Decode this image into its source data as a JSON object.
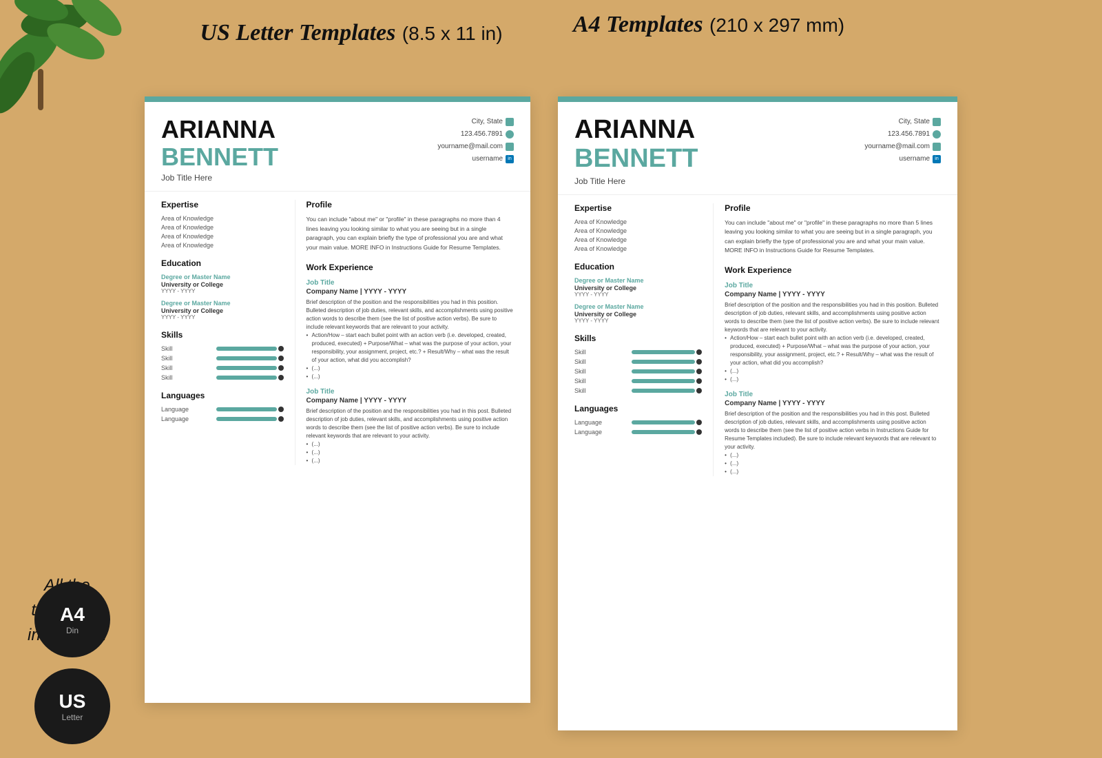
{
  "page": {
    "background_color": "#d4a96a"
  },
  "labels": {
    "us_template_title": "US Letter Templates",
    "us_template_size": "(8.5 x 11 in)",
    "a4_template_title": "A4 Templates",
    "a4_template_size": "(210 x 297 mm)",
    "side_text_line1": "All the",
    "side_text_line2": "templates",
    "side_text_line3": "included in",
    "badge_a4_main": "A4",
    "badge_a4_sub": "Din",
    "badge_us_main": "US",
    "badge_us_sub": "Letter"
  },
  "us_resume": {
    "first_name": "ARIANNA",
    "last_name": "BENNETT",
    "job_title": "Job Title Here",
    "contact": {
      "city": "City, State",
      "phone": "123.456.7891",
      "email": "yourname@mail.com",
      "username": "username"
    },
    "expertise": {
      "title": "Expertise",
      "items": [
        "Area of Knowledge",
        "Area of Knowledge",
        "Area of Knowledge",
        "Area of Knowledge"
      ]
    },
    "education": {
      "title": "Education",
      "entries": [
        {
          "degree": "Degree or Master Name",
          "school": "University or College",
          "year": "YYYY - YYYY"
        },
        {
          "degree": "Degree or Master Name",
          "school": "University or College",
          "year": "YYYY - YYYY"
        }
      ]
    },
    "skills": {
      "title": "Skills",
      "items": [
        "Skill",
        "Skill",
        "Skill",
        "Skill"
      ]
    },
    "languages": {
      "title": "Languages",
      "items": [
        "Language",
        "Language"
      ]
    },
    "profile": {
      "title": "Profile",
      "text": "You can include \"about me\" or \"profile\" in these paragraphs no more than 4 lines leaving you looking similar to what you are seeing but in a single paragraph, you can explain briefly the type of professional you are and what your main value. MORE INFO in Instructions Guide for Resume Templates."
    },
    "work_experience": {
      "title": "Work Experience",
      "jobs": [
        {
          "title": "Job Title",
          "company": "Company Name | YYYY - YYYY",
          "desc": "Brief description of the position and the responsibilities you had in this position. Bulleted description of job duties, relevant skills, and accomplishments using positive action words to describe them (see the list of positive action verbs). Be sure to include relevant keywords that are relevant to your activity.",
          "bullets": [
            "Action/How – start each bullet point with an action verb (i.e. developed, created, produced, executed) + Purpose/What – what was the purpose of your action, your responsibility, your assignment, project, etc.? + Result/Why – what was the result of your action, what did you accomplish?",
            "(...)",
            "(...)"
          ]
        },
        {
          "title": "Job Title",
          "company": "Company Name | YYYY - YYYY",
          "desc": "Brief description of the position and the responsibilities you had in this post. Bulleted description of job duties, relevant skills, and accomplishments using positive action words to describe them (see the list of positive action verbs). Be sure to include relevant keywords that are relevant to your activity.",
          "bullets": [
            "(...)",
            "(...)",
            "(...)"
          ]
        }
      ]
    }
  },
  "a4_resume": {
    "first_name": "ARIANNA",
    "last_name": "BENNETT",
    "job_title": "Job Title Here",
    "contact": {
      "city": "City, State",
      "phone": "123.456.7891",
      "email": "yourname@mail.com",
      "username": "username"
    },
    "expertise": {
      "title": "Expertise",
      "items": [
        "Area of Knowledge",
        "Area of Knowledge",
        "Area of Knowledge",
        "Area of Knowledge"
      ]
    },
    "education": {
      "title": "Education",
      "entries": [
        {
          "degree": "Degree or Master Name",
          "school": "University or College",
          "year": "YYYY - YYYY"
        },
        {
          "degree": "Degree or Master Name",
          "school": "University or College",
          "year": "YYYY - YYYY"
        }
      ]
    },
    "skills": {
      "title": "Skills",
      "items": [
        "Skill",
        "Skill",
        "Skill",
        "Skill",
        "Skill"
      ]
    },
    "languages": {
      "title": "Languages",
      "items": [
        "Language",
        "Language"
      ]
    },
    "profile": {
      "title": "Profile",
      "text": "You can include \"about me\" or \"profile\" in these paragraphs no more than 5 lines leaving you looking similar to what you are seeing but in a single paragraph, you can explain briefly the type of professional you are and what your main value. MORE INFO in Instructions Guide for Resume Templates."
    },
    "work_experience": {
      "title": "Work Experience",
      "jobs": [
        {
          "title": "Job Title",
          "company": "Company Name | YYYY - YYYY",
          "desc": "Brief description of the position and the responsibilities you had in this position. Bulleted description of job duties, relevant skills, and accomplishments using positive action words to describe them (see the list of positive action verbs). Be sure to include relevant keywords that are relevant to your activity.",
          "bullets": [
            "Action/How – start each bullet point with an action verb (i.e. developed, created, produced, executed) + Purpose/What – what was the purpose of your action, your responsibility, your assignment, project, etc.? + Result/Why – what was the result of your action, what did you accomplish?",
            "(...)",
            "(...)"
          ]
        },
        {
          "title": "Job Title",
          "company": "Company Name | YYYY - YYYY",
          "desc": "Brief description of the position and the responsibilities you had in this post. Bulleted description of job duties, relevant skills, and accomplishments using positive action words to describe them (see the list of positive action verbs in Instructions Guide for Resume Templates included). Be sure to include relevant keywords that are relevant to your activity.",
          "bullets": [
            "(...)",
            "(...)",
            "(...)"
          ]
        }
      ]
    }
  }
}
